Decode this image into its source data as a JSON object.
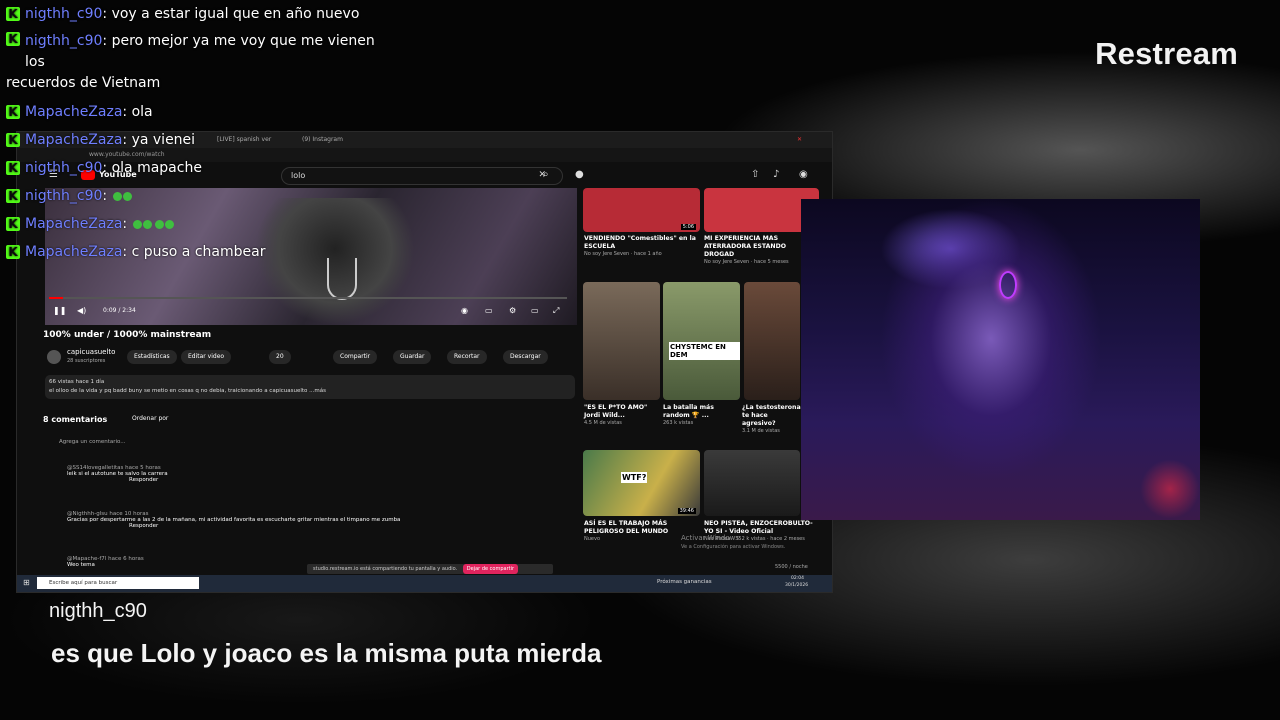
{
  "brand": "Restream",
  "chat": [
    {
      "user": "nigthh_c90",
      "text": "voy a estar igual que en año nuevo"
    },
    {
      "user": "nigthh_c90",
      "text": "pero mejor ya me voy que me vienen los",
      "cont": "recuerdos de Vietnam"
    },
    {
      "user": "MapacheZaza",
      "text": "ola"
    },
    {
      "user": "MapacheZaza",
      "text": "ya vienei"
    },
    {
      "user": "nigthh_c90",
      "text": "ola mapache"
    },
    {
      "user": "nigthh_c90",
      "text": ""
    },
    {
      "user": "MapacheZaza",
      "text": ""
    },
    {
      "user": "MapacheZaza",
      "text": "c puso a chambear"
    }
  ],
  "chat_badge": "K",
  "alert": {
    "user": "nigthh_c90",
    "text": "es que Lolo y joaco es la misma puta mierda"
  },
  "screen": {
    "tabs": [
      "[LIVE] spanish ver",
      "(9) Instagram"
    ],
    "url": "www.youtube.com/watch",
    "yt_name": "YouTube",
    "search_query": "lolo",
    "time": "0:09 / 2:34",
    "video_title": "100% under / 1000% mainstream",
    "channel": "capicuasuelto",
    "subs": "28 suscriptores",
    "pills": [
      "Estadísticas",
      "Editar video",
      "20",
      "Compartir",
      "Guardar",
      "Recortar",
      "Descargar"
    ],
    "desc_line1": "66 vistas  hace 1 día",
    "desc_line2": "el olloo de la vida y pq badd buny se metio en cosas q no debia, traicionando a capicuasuelto ...más",
    "comments_header": "8 comentarios",
    "sort_label": "Ordenar por",
    "add_comment": "Agrega un comentario...",
    "comments": [
      {
        "user": "@SS14lovegalletitas",
        "age": "hace 5 horas",
        "text": "leik si el autotune te salvo la carrera"
      },
      {
        "user": "@Nigthhh-glsu",
        "age": "hace 10 horas",
        "text": "Gracias por despertarme a las 2 de la mañana, mi actividad favorita es escucharte gritar mientras el timpano me zumba"
      },
      {
        "user": "@Mapache-f7l",
        "age": "hace 6 horas",
        "text": "Weo tema"
      }
    ],
    "reply_label": "Responder",
    "recommended": [
      {
        "title": "VENDIENDO \"Comestibles\" en la ESCUELA",
        "meta": "No soy Jere Seven · hace 1 año",
        "dur": "5:06"
      },
      {
        "title": "MI EXPERIENCIA MAS ATERRADORA ESTANDO DROGAD",
        "meta": "No soy Jere Seven · hace 5 meses",
        "dur": ""
      },
      {
        "title": "\"ES EL P*TO AMO\" Jordi Wild...",
        "meta": "4.5 M de vistas",
        "dur": ""
      },
      {
        "title": "La batalla más random 🏆 ...",
        "meta": "263 k vistas",
        "dur": ""
      },
      {
        "title": "¿La testosterona te hace agresivo?",
        "meta": "3.1 M de vistas",
        "dur": ""
      },
      {
        "title": "ASÍ ES EL TRABAJO MÁS PELIGROSO DEL MUNDO",
        "meta": "Nuevo",
        "dur": "39:46"
      },
      {
        "title": "NEO PISTEA, ENZOCEROBULTO-YO SI - Video Oficial",
        "meta": "Neo Pistea · 352 k vistas · hace 2 meses",
        "dur": ""
      }
    ],
    "thumb_text": [
      "CHYSTEMC EN DEM",
      "WTF?"
    ],
    "share_text": "studio.restream.io está compartiendo tu pantalla y audio.",
    "share_button": "Dejar de compartir",
    "activate": "Activar Windows",
    "activate_sub": "Ve a Configuración para activar Windows.",
    "taskbar_search": "Escribe aquí para buscar",
    "taskbar_right": "Próximas ganancias",
    "clock_time": "02:04",
    "clock_date": "30/1/2026",
    "price": "5500 / noche"
  }
}
